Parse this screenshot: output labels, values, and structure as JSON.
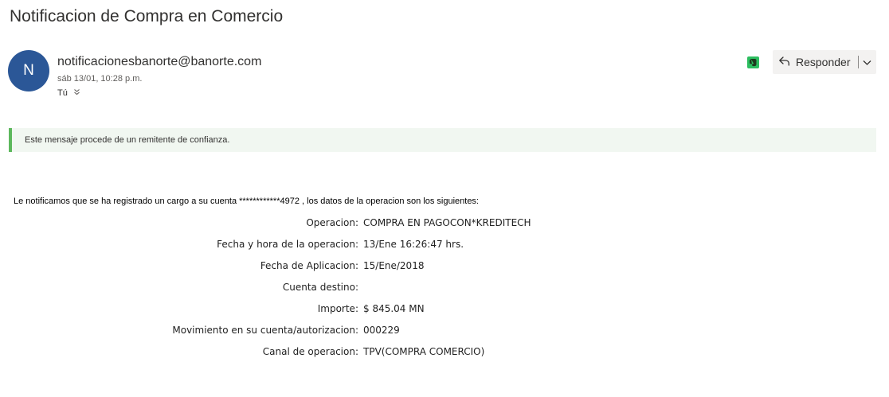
{
  "subject": "Notificacion de Compra en Comercio",
  "sender": {
    "initial": "N",
    "email": "notificacionesbanorte@banorte.com",
    "date": "sáb 13/01, 10:28 p.m.",
    "to_label": "Tú",
    "avatar_color": "#2b5797"
  },
  "actions": {
    "reply_label": "Responder",
    "extension_icon": "evernote-icon",
    "extension_color": "#2dbe60"
  },
  "trust_banner": {
    "text": "Este mensaje procede de un remitente de confianza.",
    "accent_color": "#5cb85c"
  },
  "body": {
    "intro": "Le notificamos que se ha registrado un cargo a su cuenta ************4972 , los datos de la operacion son los siguientes:",
    "rows": [
      {
        "label": "Operacion:",
        "value": "COMPRA EN PAGOCON*KREDITECH"
      },
      {
        "label": "Fecha y hora de la operacion:",
        "value": "13/Ene 16:26:47 hrs."
      },
      {
        "label": "Fecha de Aplicacion:",
        "value": "15/Ene/2018"
      },
      {
        "label": "Cuenta destino:",
        "value": ""
      },
      {
        "label": "Importe:",
        "value": "$ 845.04 MN"
      },
      {
        "label": "Movimiento en su cuenta/autorizacion:",
        "value": "000229"
      },
      {
        "label": "Canal de operacion:",
        "value": "TPV(COMPRA COMERCIO)"
      }
    ]
  }
}
